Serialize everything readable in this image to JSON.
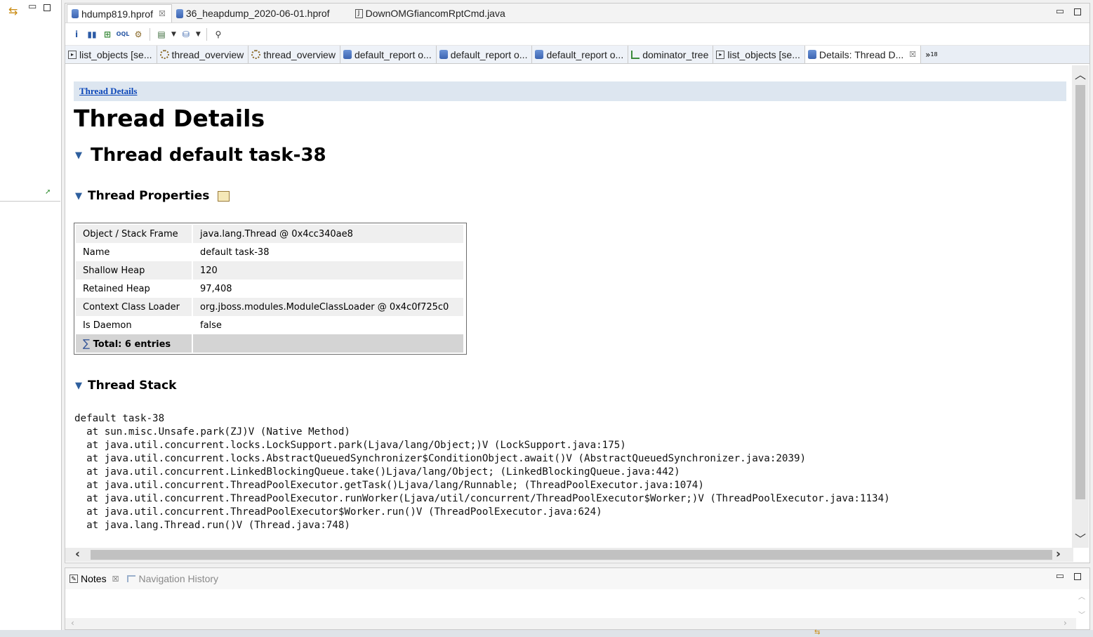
{
  "file_tabs": [
    {
      "label": "hdump819.hprof",
      "icon": "heap-dump-icon",
      "active": true,
      "closable": true
    },
    {
      "label": "36_heapdump_2020-06-01.hprof",
      "icon": "heap-dump-icon",
      "active": false
    },
    {
      "label": "DownOMGfiancomRptCmd.java",
      "icon": "java-file-icon",
      "active": false
    }
  ],
  "toolbar": {
    "icons": [
      "info-icon",
      "histogram-icon",
      "dominator-tree-icon",
      "oql-icon",
      "thread-overview-icon",
      "query-browser-icon",
      "report-icon",
      "search-icon"
    ]
  },
  "result_tabs": [
    {
      "label": "list_objects  [se...",
      "icon": "list-objects-icon"
    },
    {
      "label": "thread_overview",
      "icon": "thread-overview-icon"
    },
    {
      "label": "thread_overview",
      "icon": "thread-overview-icon"
    },
    {
      "label": "default_report  o...",
      "icon": "report-icon"
    },
    {
      "label": "default_report  o...",
      "icon": "report-icon"
    },
    {
      "label": "default_report  o...",
      "icon": "report-icon"
    },
    {
      "label": "dominator_tree",
      "icon": "dominator-tree-icon"
    },
    {
      "label": "list_objects  [se...",
      "icon": "list-objects-icon"
    },
    {
      "label": "Details: Thread D...",
      "icon": "report-icon",
      "active": true,
      "closable": true
    }
  ],
  "result_tabs_overflow": {
    "chevron": "»",
    "count": "18"
  },
  "page": {
    "breadcrumb": "Thread Details",
    "title": "Thread Details",
    "thread_heading": "Thread default task-38",
    "properties_heading": "Thread Properties",
    "stack_heading": "Thread Stack"
  },
  "properties": {
    "rows": [
      {
        "key": "Object / Stack Frame",
        "value": "java.lang.Thread @ 0x4cc340ae8"
      },
      {
        "key": "Name",
        "value": "default task-38"
      },
      {
        "key": "Shallow Heap",
        "value": "120"
      },
      {
        "key": "Retained Heap",
        "value": "97,408"
      },
      {
        "key": "Context Class Loader",
        "value": "org.jboss.modules.ModuleClassLoader @ 0x4c0f725c0"
      },
      {
        "key": "Is Daemon",
        "value": "false"
      }
    ],
    "total_symbol": "∑",
    "total_label": "Total: 6 entries"
  },
  "stack_trace": "default task-38\n  at sun.misc.Unsafe.park(ZJ)V (Native Method)\n  at java.util.concurrent.locks.LockSupport.park(Ljava/lang/Object;)V (LockSupport.java:175)\n  at java.util.concurrent.locks.AbstractQueuedSynchronizer$ConditionObject.await()V (AbstractQueuedSynchronizer.java:2039)\n  at java.util.concurrent.LinkedBlockingQueue.take()Ljava/lang/Object; (LinkedBlockingQueue.java:442)\n  at java.util.concurrent.ThreadPoolExecutor.getTask()Ljava/lang/Runnable; (ThreadPoolExecutor.java:1074)\n  at java.util.concurrent.ThreadPoolExecutor.runWorker(Ljava/util/concurrent/ThreadPoolExecutor$Worker;)V (ThreadPoolExecutor.java:1134)\n  at java.util.concurrent.ThreadPoolExecutor$Worker.run()V (ThreadPoolExecutor.java:624)\n  at java.lang.Thread.run()V (Thread.java:748)",
  "bottom_tabs": [
    {
      "label": "Notes",
      "icon": "notes-icon",
      "active": true,
      "closable": true
    },
    {
      "label": "Navigation History",
      "icon": "navigation-history-icon",
      "active": false
    }
  ],
  "colors": {
    "breadcrumb_bar": "#dde6f0",
    "link": "#0b46b8",
    "section_triangle": "#2e5f9e",
    "table_total_row": "#d4d4d4"
  }
}
